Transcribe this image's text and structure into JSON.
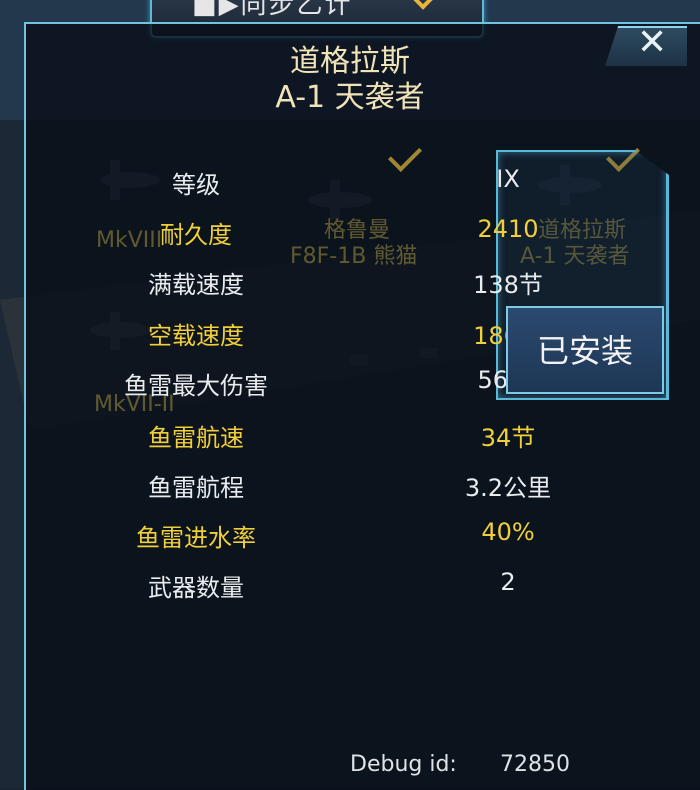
{
  "header": {
    "tab_label": "■▶同步乙计"
  },
  "dialog": {
    "title_line1": "道格拉斯",
    "title_line2": "A-1 天袭者",
    "close_symbol": "✕"
  },
  "stats": [
    {
      "label": "等级",
      "value": "IX",
      "color": "white"
    },
    {
      "label": "耐久度",
      "value": "2410",
      "color": "yellow"
    },
    {
      "label": "满载速度",
      "value": "138节",
      "color": "white"
    },
    {
      "label": "空载速度",
      "value": "186节",
      "color": "yellow"
    },
    {
      "label": "鱼雷最大伤害",
      "value": "5600",
      "color": "white"
    },
    {
      "label": "鱼雷航速",
      "value": "34节",
      "color": "yellow"
    },
    {
      "label": "鱼雷航程",
      "value": "3.2公里",
      "color": "white"
    },
    {
      "label": "鱼雷进水率",
      "value": "40%",
      "color": "yellow"
    },
    {
      "label": "武器数量",
      "value": "2",
      "color": "white"
    }
  ],
  "background_aircraft": {
    "ghost1_name": "格鲁曼",
    "ghost2_name": "F8F-1B 熊猫",
    "ghost3_name": "道格拉斯",
    "ghost4_name": "A-1 天袭者",
    "ghost5_name": "MkVIII",
    "ghost6_name": "MkVII-II"
  },
  "installed_button": {
    "label": "已安装"
  },
  "debug": {
    "label": "Debug id:",
    "value": "72850"
  },
  "colors": {
    "accent": "#58b9d9",
    "label_yellow": "#f0cf3a",
    "title_gold": "#f0e3b8"
  }
}
